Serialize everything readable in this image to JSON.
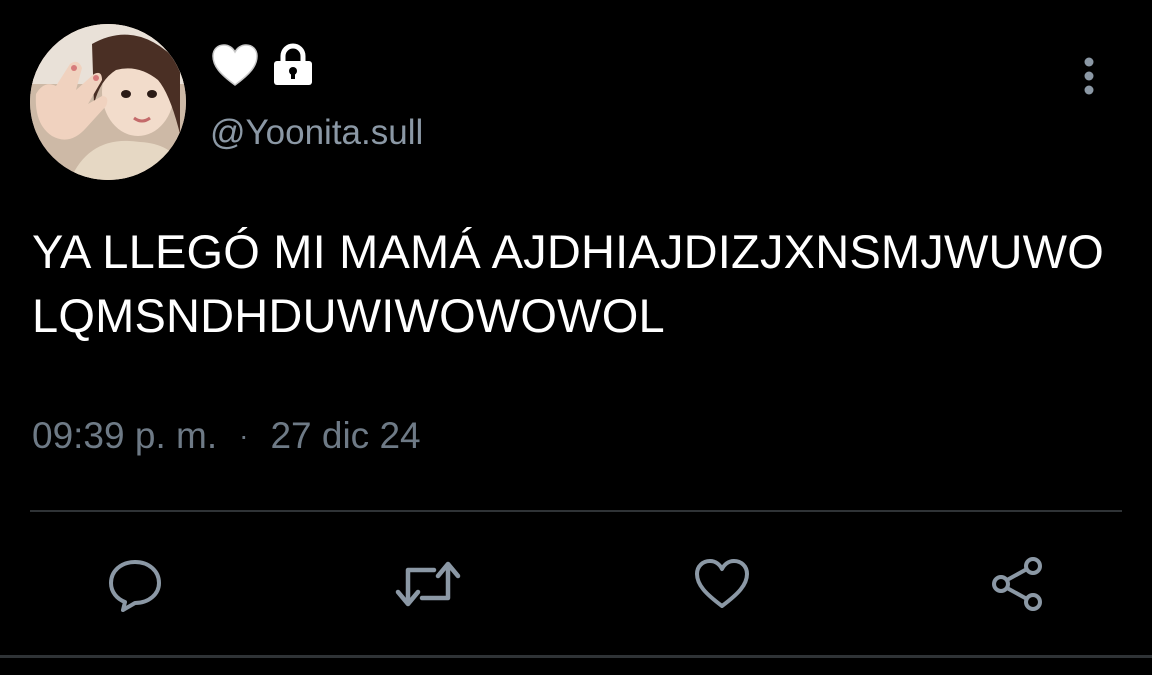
{
  "user": {
    "handle": "@Yoonita.sull",
    "name_emoji": "heart-white",
    "protected_icon": "lock-icon"
  },
  "tweet": {
    "text": "YA LLEGÓ MI MAMÁ AJDHIAJDIZJXNSMJWUWO LQMSNDHDUWIWOWOWOL",
    "time": "09:39 p. m.",
    "separator": "·",
    "date": "27 dic 24"
  },
  "actions": {
    "reply_icon": "reply-icon",
    "retweet_icon": "retweet-icon",
    "like_icon": "heart-outline-icon",
    "share_icon": "share-icon"
  },
  "colors": {
    "background": "#000000",
    "text": "#ffffff",
    "secondary": "#8b98a5",
    "meta": "#6e7a86",
    "divider": "#2f3336"
  }
}
